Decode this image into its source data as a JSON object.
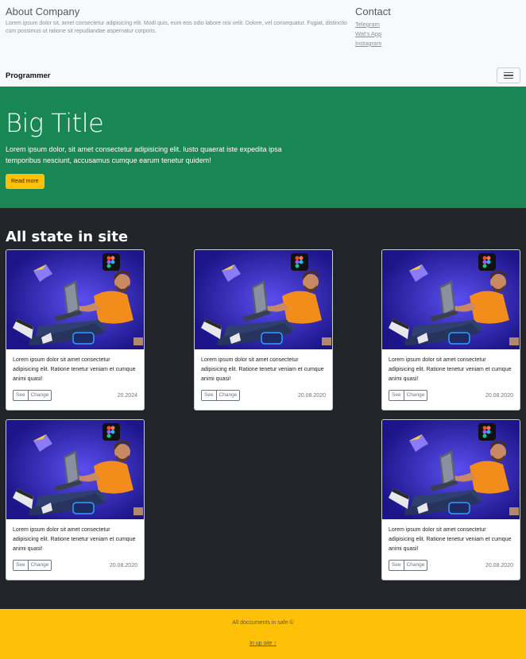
{
  "about": {
    "title": "About Company",
    "text": "Lorem ipsum dolor sit, amet consectetur adipisicing elit. Modi quis, eum eos odio labore nisi velit. Dolore, vel consequatur. Fugiat, distinctio cum possimus ut ratione sit repudiandae aspernatur corporis."
  },
  "contact": {
    "title": "Contact",
    "links": [
      "Telegram",
      "Wat's App",
      "Instagram"
    ]
  },
  "navbar": {
    "brand": "Programmer"
  },
  "hero": {
    "title": "Big Title",
    "text": "Lorem ipsum dolor, sit amet consectetur adipisicing elit. Iusto quaerat iste expedita ipsa temporibus nesciunt, accusamus cumque earum tenetur quidem!",
    "button": "Read more"
  },
  "section": {
    "title": "All state in site"
  },
  "cards": [
    {
      "text": "Lorem ipsum dolor sit amet consectetur adipisicing elit. Ratione tenetur veniam et cumque animi quasi!",
      "see": "See",
      "change": "Change",
      "date": "20.2024"
    },
    {
      "text": "Lorem ipsum dolor sit amet consectetur adipisicing elit. Ratione tenetur veniam et cumque animi quasi!",
      "see": "See",
      "change": "Change",
      "date": "20.08.2020"
    },
    {
      "text": "Lorem ipsum dolor sit amet consectetur adipisicing elit. Ratione tenetur veniam et cumque animi quasi!",
      "see": "See",
      "change": "Change",
      "date": "20.08.2020"
    },
    {
      "text": "Lorem ipsum dolor sit amet consectetur adipisicing elit. Ratione tenetur veniam et cumque animi quasi!",
      "see": "See",
      "change": "Change",
      "date": "20.08.2020"
    },
    {
      "text": "Lorem ipsum dolor sit amet consectetur adipisicing elit. Ratione tenetur veniam et cumque animi quasi!",
      "see": "See",
      "change": "Change",
      "date": "20.08.2020"
    }
  ],
  "footer": {
    "copyright": "All doccuments in safe ©",
    "link": "In up site ↑"
  },
  "colors": {
    "hero_bg": "#198754",
    "section_bg": "#212529",
    "footer_bg": "#ffc107",
    "button_bg": "#ffc107"
  }
}
